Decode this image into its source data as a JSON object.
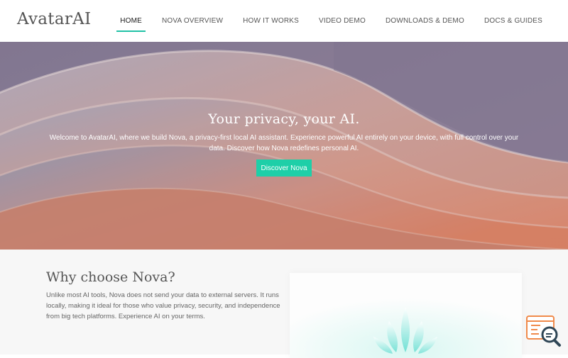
{
  "brand": {
    "logo_text": "AvatarAI"
  },
  "nav": {
    "items": [
      {
        "label": "HOME",
        "active": true
      },
      {
        "label": "NOVA OVERVIEW",
        "active": false
      },
      {
        "label": "HOW IT WORKS",
        "active": false
      },
      {
        "label": "VIDEO DEMO",
        "active": false
      },
      {
        "label": "DOWNLOADS & DEMO",
        "active": false
      },
      {
        "label": "DOCS & GUIDES",
        "active": false
      }
    ]
  },
  "hero": {
    "title": "Your privacy, your AI.",
    "text": "Welcome to AvatarAI, where we build Nova, a privacy-first local AI assistant. Experience powerful AI entirely on your device, with full control over your data. Discover how Nova redefines personal AI.",
    "cta_label": "Discover Nova"
  },
  "why": {
    "title": "Why choose Nova?",
    "text": "Unlike most AI tools, Nova does not send your data to external servers. It runs locally, making it ideal for those who value privacy, security, and independence from big tech platforms. Experience AI on your terms."
  },
  "colors": {
    "accent": "#1ecfa8",
    "nav_underline": "#21c1a6",
    "help_widget": "#f08a4b"
  },
  "icons": {
    "help_widget": "help-search-icon"
  }
}
